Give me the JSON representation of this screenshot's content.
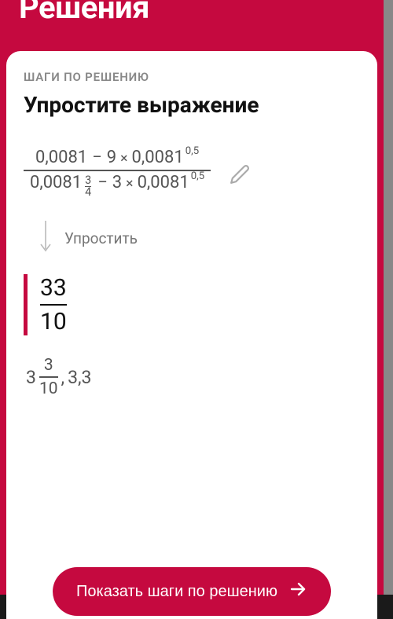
{
  "header": {
    "title": "Решения"
  },
  "card": {
    "steps_label": "ШАГИ ПО РЕШЕНИЮ",
    "title": "Упростите выражение",
    "expr": {
      "num_a": "0,0081",
      "num_minus": "−",
      "num_b": "9",
      "num_mul": "×",
      "num_c": "0,0081",
      "num_c_pow": "0,5",
      "den_a": "0,0081",
      "den_a_pow_n": "3",
      "den_a_pow_d": "4",
      "den_minus": "−",
      "den_b": "3",
      "den_mul": "×",
      "den_c": "0,0081",
      "den_c_pow": "0,5"
    },
    "step_label": "Упростить",
    "result": {
      "num": "33",
      "den": "10"
    },
    "alt": {
      "mixed_int": "3",
      "mixed_num": "3",
      "mixed_den": "10",
      "sep": " , ",
      "decimal": "3,3"
    },
    "cta_label": "Показать шаги по решению"
  },
  "icons": {
    "edit": "pencil-icon",
    "arrow_down": "arrow-down-icon",
    "arrow_right": "arrow-right-icon"
  }
}
